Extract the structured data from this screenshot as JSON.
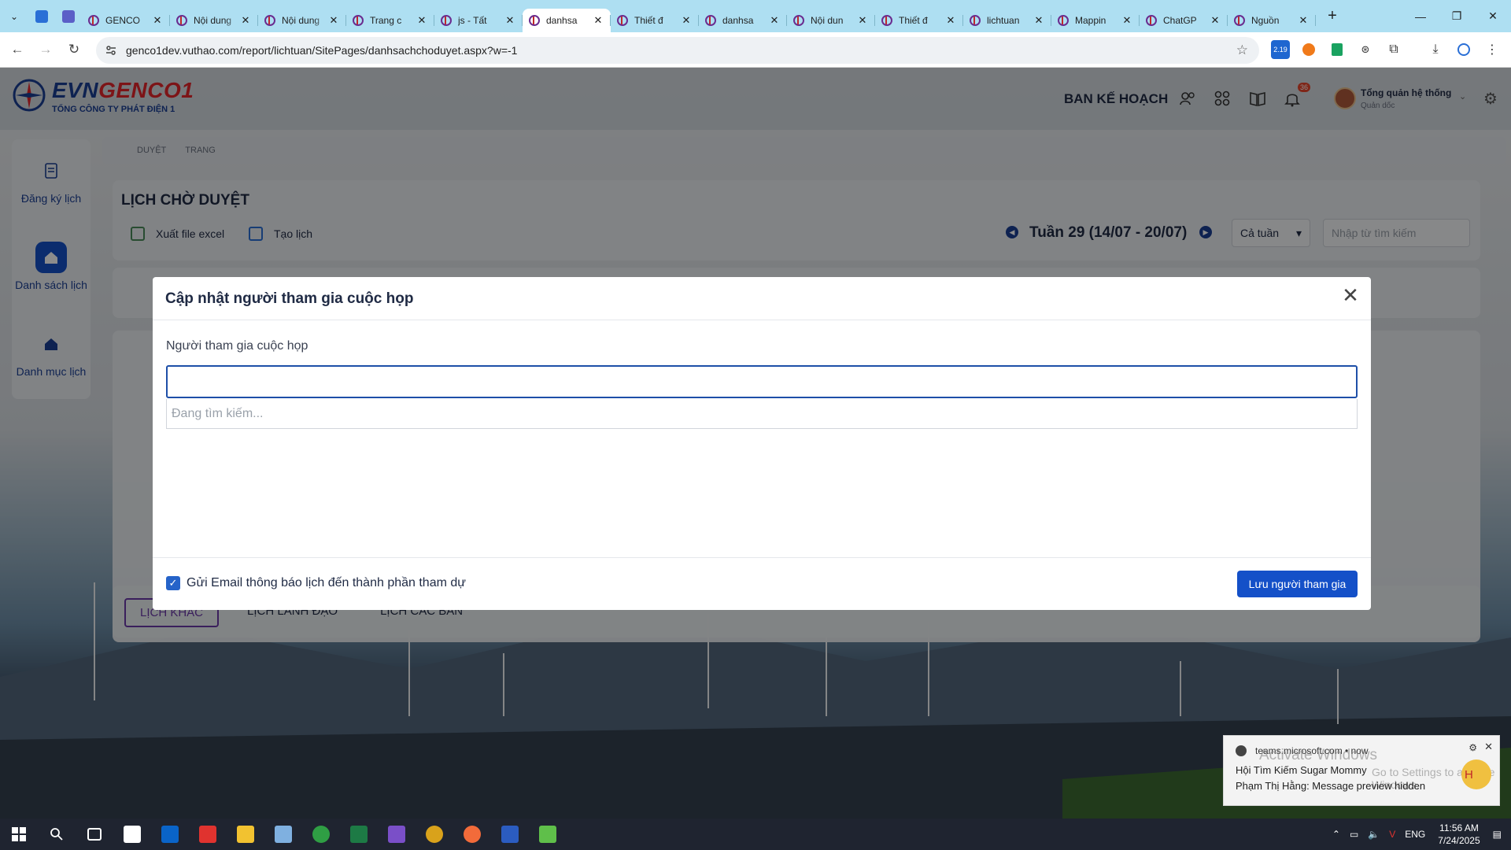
{
  "browser": {
    "tabs": [
      {
        "title": "GENCO"
      },
      {
        "title": "Nội dung"
      },
      {
        "title": "Nội dung"
      },
      {
        "title": "Trang c"
      },
      {
        "title": "js - Tất"
      },
      {
        "title": "danhsa",
        "active": true
      },
      {
        "title": "Thiết đ"
      },
      {
        "title": "danhsa"
      },
      {
        "title": "Nội dun"
      },
      {
        "title": "Thiết đ"
      },
      {
        "title": "lichtuan"
      },
      {
        "title": "Mappin"
      },
      {
        "title": "ChatGP"
      },
      {
        "title": "Nguồn"
      }
    ],
    "new_tab": "+",
    "url": "genco1dev.vuthao.com/report/lichtuan/SitePages/danhsachchoduyet.aspx?w=-1",
    "extension_badge": "2.19"
  },
  "app": {
    "logo": {
      "brand_a": "EVN",
      "brand_b": "GENCO1",
      "subtitle": "TỔNG CÔNG TY PHÁT ĐIỆN 1"
    },
    "department": "BAN KẾ HOẠCH",
    "notification_count": "36",
    "user": {
      "name": "Tổng quản hệ thống",
      "role": "Quản dốc"
    },
    "sidebar": [
      {
        "label": "Đăng ký lịch"
      },
      {
        "label": "Danh sách lịch"
      },
      {
        "label": "Danh mục lịch"
      }
    ],
    "breadcrumb": [
      "DUYỆT",
      "TRANG"
    ],
    "page_title": "LỊCH CHỜ DUYỆT",
    "toolbar": {
      "export": "Xuất file excel",
      "create": "Tạo lịch"
    },
    "week_label": "Tuần 29 (14/07 - 20/07)",
    "week_filter": "Cả tuần",
    "search_placeholder": "Nhập từ tìm kiếm",
    "bottom_tabs": [
      "LỊCH KHÁC",
      "LỊCH LÃNH ĐẠO",
      "LỊCH CÁC BAN"
    ]
  },
  "modal": {
    "title": "Cập nhật người tham gia cuộc họp",
    "field_label": "Người tham gia cuộc họp",
    "input_value": "",
    "searching_text": "Đang tìm kiếm...",
    "send_email_label": "Gửi Email thông báo lịch đến thành phần tham dự",
    "send_email_checked": true,
    "save_button": "Lưu người tham gia",
    "close_symbol": "✕"
  },
  "notification": {
    "source": "teams.microsoft.com • now",
    "line1": "Hội Tìm Kiếm Sugar Mommy",
    "line2": "Phạm Thị Hằng: Message preview hidden",
    "watermark_1": "Activate Windows",
    "watermark_2": "Go to Settings to activate Windows.",
    "avatar_letter": "H"
  },
  "taskbar": {
    "language": "ENG",
    "time": "11:56 AM",
    "date": "7/24/2025"
  },
  "colors": {
    "primary": "#1450c8",
    "brand_blue": "#1b3f94",
    "brand_red": "#e3262b",
    "tabbar": "#aedff2"
  }
}
